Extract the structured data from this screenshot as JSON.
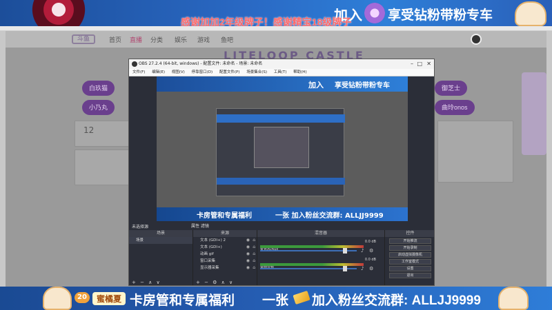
{
  "top_banner": {
    "join": "加入",
    "vip": "享受钻粉带粉专车",
    "scroll": "感谢加加2年级牌子！感谢精宝18级牌子"
  },
  "site": {
    "logo": "斗鱼",
    "nav": [
      "首页",
      "直播",
      "分类",
      "娱乐",
      "游戏",
      "鱼吧"
    ],
    "hero": "LITELOOP CASTLE",
    "pills_left": [
      "白玖猫",
      "小乃丸"
    ],
    "pills_right": [
      "御芝士",
      "曲玲onos"
    ],
    "count": "12"
  },
  "obs": {
    "title": "OBS 27.2.4 (64-bit, windows) - 配置文件: 未命名 - 场景: 未命名",
    "menu": [
      "文件(F)",
      "编辑(E)",
      "视图(V)",
      "停靠窗口(D)",
      "配置文件(P)",
      "场景集合(S)",
      "工具(T)",
      "帮助(H)"
    ],
    "preview": {
      "banner_top_a": "加入",
      "banner_top_b": "享受钻粉带粉专车",
      "banner_bot_a": "卡房管和专属福利",
      "banner_bot_b": "一张 加入粉丝交流群: ALLJJ9999"
    },
    "scene_label": "未选择源",
    "scene_ctrl": "属性 滤镜",
    "panels": {
      "scenes": {
        "title": "场景",
        "items": [
          "场景"
        ]
      },
      "sources": {
        "title": "来源",
        "items": [
          "文本 (GDI+) 2",
          "文本 (GDI+)",
          "动画 gif",
          "窗口采集",
          "显示器采集"
        ]
      },
      "mixer": {
        "title": "混音器",
        "channels": [
          {
            "label": "麦克风/Aux",
            "db": "0.0 dB"
          },
          {
            "label": "桌面音频",
            "db": "0.0 dB"
          }
        ]
      },
      "controls": {
        "title": "控件",
        "buttons": [
          "开始推流",
          "开始录制",
          "启动虚拟摄像机",
          "工作室模式",
          "设置",
          "退出"
        ]
      }
    }
  },
  "bottom_banner": {
    "level": "20",
    "name": "蜜橘夏",
    "card": "卡房管和专属福利",
    "one": "一张",
    "join_fans": "加入粉丝交流群: ALLJJ9999"
  },
  "colors": {
    "banner_blue": "#2a69c4",
    "obs_bg": "#2b2e38",
    "accent_purple": "#6a3f8d"
  }
}
